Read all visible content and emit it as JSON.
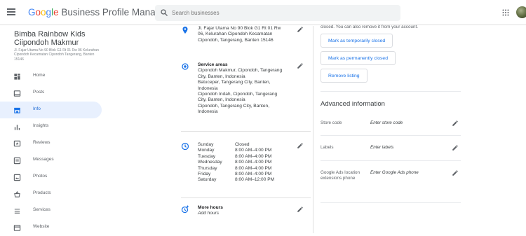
{
  "header": {
    "brand_google": "Google",
    "brand_product": "Business Profile Manager",
    "search_placeholder": "Search businesses"
  },
  "business": {
    "name": "Bimba Rainbow Kids Ciipondoh Makmur",
    "address": "Jl. Fajar Utama No 90 Blok G1 Rt 01 Rw 06 Kelurahan Cipondoh Kecamatan Cipondoh Tangerang, Banten 15146"
  },
  "nav": [
    {
      "label": "Home",
      "icon": "home-icon"
    },
    {
      "label": "Posts",
      "icon": "posts-icon"
    },
    {
      "label": "Info",
      "icon": "info-store-icon",
      "active": true
    },
    {
      "label": "Insights",
      "icon": "insights-icon"
    },
    {
      "label": "Reviews",
      "icon": "reviews-icon"
    },
    {
      "label": "Messages",
      "icon": "messages-icon"
    },
    {
      "label": "Photos",
      "icon": "photos-icon"
    },
    {
      "label": "Products",
      "icon": "products-icon"
    },
    {
      "label": "Services",
      "icon": "services-icon"
    },
    {
      "label": "Website",
      "icon": "website-icon"
    }
  ],
  "info": {
    "address_lines": [
      "Jl. Fajar Utama No 90 Blok G1 Rt 01 Rw",
      "06, Kelurahan Cipondoh Kecamatan",
      "Cipondoh, Tangerang, Banten 15146"
    ],
    "service_areas_title": "Service areas",
    "service_areas_lines": [
      "Cipondoh Makmur, Cipondoh, Tangerang",
      "City, Banten, Indonesia",
      "Batuceper, Tangerang City, Banten,",
      "Indonesia",
      "Cipondoh Indah, Cipondoh, Tangerang",
      "City, Banten, Indonesia",
      "Cipondoh, Tangerang City, Banten,",
      "Indonesia"
    ],
    "hours": [
      {
        "day": "Sunday",
        "time": "Closed"
      },
      {
        "day": "Monday",
        "time": "8:00 AM–4:00 PM"
      },
      {
        "day": "Tuesday",
        "time": "8:00 AM–4:00 PM"
      },
      {
        "day": "Wednesday",
        "time": "8:00 AM–4:00 PM"
      },
      {
        "day": "Thursday",
        "time": "8:00 AM–4:00 PM"
      },
      {
        "day": "Friday",
        "time": "8:00 AM–4:00 PM"
      },
      {
        "day": "Saturday",
        "time": "8:00 AM–12:00 PM"
      }
    ],
    "more_hours_title": "More hours",
    "more_hours_sub": "Add hours"
  },
  "right": {
    "notice": "closed. You can also remove it from your account.",
    "btn_temp": "Mark as temporarily closed",
    "btn_perm": "Mark as permanently closed",
    "btn_remove": "Remove listing",
    "advanced_title": "Advanced information",
    "store_code_label": "Store code",
    "store_code_value": "Enter store code",
    "labels_label": "Labels",
    "labels_value": "Enter labels",
    "ads_label": "Google Ads location extensions phone",
    "ads_value": "Enter Google Ads phone"
  },
  "colors": {
    "accent": "#1a73e8",
    "active_bg": "#e8f0fe",
    "icon_blue": "#1a73e8"
  }
}
